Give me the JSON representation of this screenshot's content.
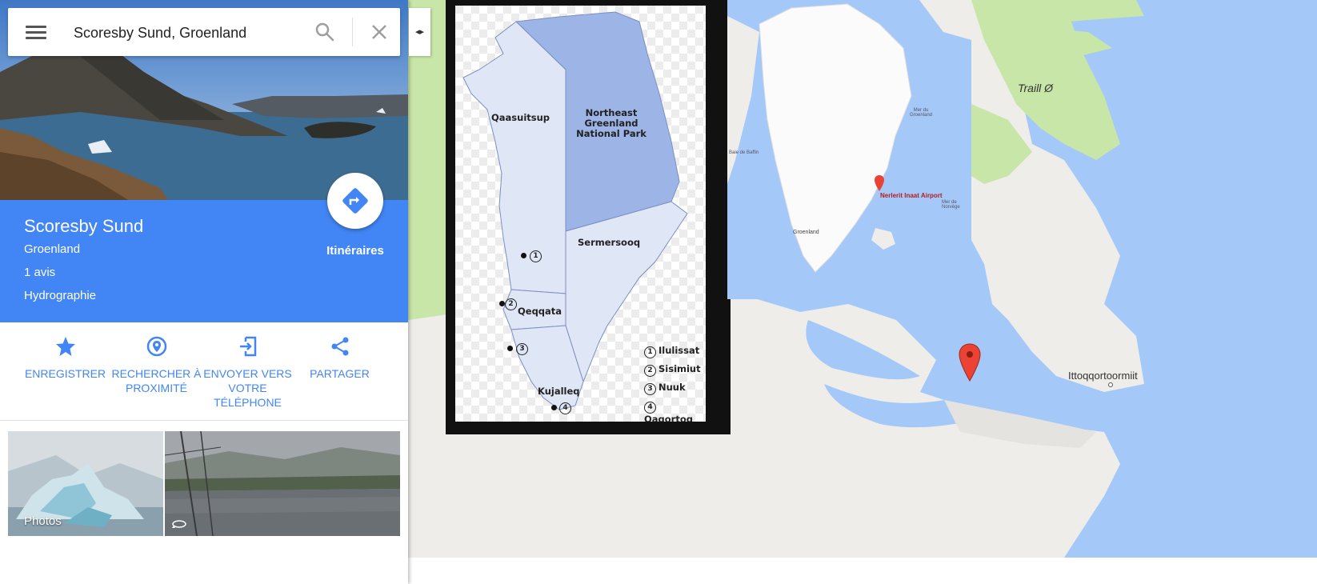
{
  "search": {
    "value": "Scoresby Sund, Groenland"
  },
  "place": {
    "title": "Scoresby Sund",
    "region": "Groenland",
    "reviews": "1 avis",
    "category": "Hydrographie",
    "directions_label": "Itinéraires"
  },
  "actions": [
    {
      "label": "ENREGISTRER",
      "icon": "star-icon"
    },
    {
      "label": "RECHERCHER À PROXIMITÉ",
      "icon": "nearby-pin-icon"
    },
    {
      "label": "ENVOYER VERS VOTRE TÉLÉPHONE",
      "icon": "send-to-phone-icon"
    },
    {
      "label": "PARTAGER",
      "icon": "share-icon"
    }
  ],
  "photos": {
    "label": "Photos"
  },
  "map": {
    "labels": {
      "traill": "Traill Ø",
      "ittoq": "Ittoqqortoormiit"
    }
  },
  "region_map": {
    "regions": [
      "Qaasuitsup",
      "Northeast Greenland National Park",
      "Sermersooq",
      "Qeqqata",
      "Kujalleq"
    ],
    "legend": [
      {
        "num": "1",
        "name": "Ilulissat"
      },
      {
        "num": "2",
        "name": "Sisimiut"
      },
      {
        "num": "3",
        "name": "Nuuk"
      },
      {
        "num": "4",
        "name": "Qaqortoq"
      }
    ]
  },
  "inset_map": {
    "airport": "Nerlerit Inaat Airport",
    "greenland": "Groenland",
    "sea1": "Mer du Groenland",
    "sea2": "Mer de Norvège",
    "baffin": "Baie de Baffin"
  },
  "colors": {
    "accent": "#4285f4",
    "water": "#a4c8f8",
    "land": "#f2f0ec",
    "vegetation": "#c8e6a8",
    "pin": "#ea4335"
  }
}
